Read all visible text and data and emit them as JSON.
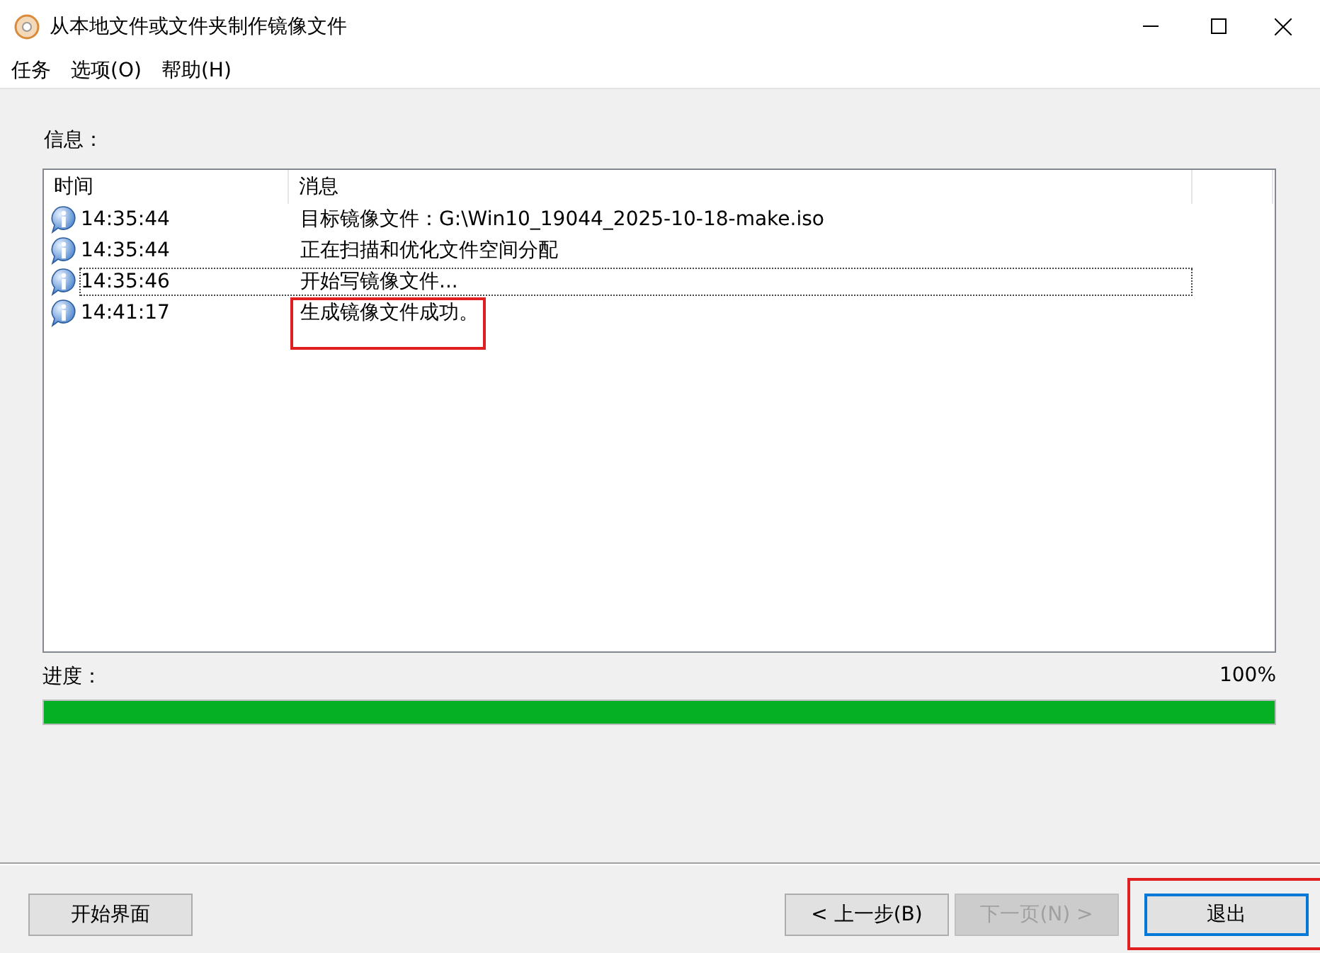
{
  "window": {
    "title": "从本地文件或文件夹制作镜像文件"
  },
  "menu": [
    "任务",
    "选项(O)",
    "帮助(H)"
  ],
  "info_label": "信息：",
  "log": {
    "columns": [
      "时间",
      "消息"
    ],
    "rows": [
      {
        "time": "14:35:44",
        "message": "目标镜像文件：G:\\Win10_19044_2025-10-18-make.iso",
        "focused": false,
        "highlighted": false
      },
      {
        "time": "14:35:44",
        "message": "正在扫描和优化文件空间分配",
        "focused": false,
        "highlighted": false
      },
      {
        "time": "14:35:46",
        "message": "开始写镜像文件...",
        "focused": true,
        "highlighted": false
      },
      {
        "time": "14:41:17",
        "message": "生成镜像文件成功。",
        "focused": false,
        "highlighted": true
      }
    ]
  },
  "progress": {
    "label": "进度：",
    "reading": "100%",
    "level": 1
  },
  "buttons": [
    {
      "label": "开始界面",
      "disabled": false,
      "default": false,
      "highlighted": false
    },
    {
      "label": "< 上一步(B)",
      "disabled": false,
      "default": false,
      "highlighted": false
    },
    {
      "label": "下一页(N) >",
      "disabled": true,
      "default": false,
      "highlighted": false
    },
    {
      "label": "退出",
      "disabled": false,
      "default": true,
      "highlighted": true
    }
  ]
}
